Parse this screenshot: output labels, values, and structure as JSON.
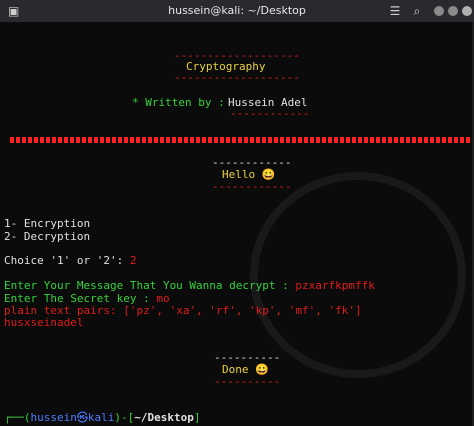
{
  "window": {
    "title": "hussein@kali: ~/Desktop"
  },
  "icons": {
    "app": "terminal-icon",
    "menu": "hamburger-menu-icon",
    "search": "search-icon"
  },
  "banner": {
    "top_rule": "-------------------",
    "title": "Cryptography",
    "bottom_rule": "-------------------",
    "written_by_label": "* Written by :",
    "author": "Hussein Adel",
    "author_rule": "------------"
  },
  "hello": {
    "rule_top": "------------",
    "text": "Hello 😀",
    "rule_bottom": "------------"
  },
  "menu": {
    "option1": "1- Encryption",
    "option2": "2- Decryption",
    "prompt": "Choice '1' or '2': ",
    "choice": "2"
  },
  "decrypt": {
    "message_prompt": "Enter Your Message That You Wanna decrypt : ",
    "message_value": "pzxarfkpmffk",
    "key_prompt": "Enter The Secret key : ",
    "key_value": "mo",
    "pairs_label": "plain text pairs: ",
    "pairs_value": "['pz', 'xa', 'rf', 'kp', 'mf', 'fk']",
    "result": "husxseinadel"
  },
  "done": {
    "rule_top": "----------",
    "text": "Done 😀",
    "rule_bottom": "----------"
  },
  "prompt": {
    "corner": "┌──(",
    "user_host": "hussein㉿kali",
    "mid": ")-[",
    "path": "~/Desktop",
    "end": "]"
  },
  "colors": {
    "red": "#e11b1b",
    "yellow": "#e8d23a",
    "green": "#36d13d",
    "blue": "#4f7cff"
  }
}
